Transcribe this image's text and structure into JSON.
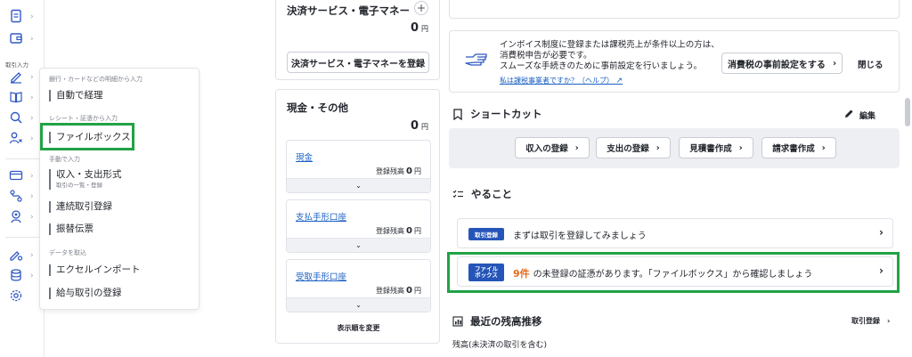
{
  "rail": {
    "label": "取引入力"
  },
  "flyout": {
    "groups": [
      "銀行・カードなどの明細から入力",
      "レシート・証憑から入力",
      "手動で入力",
      "データを取込"
    ],
    "items": {
      "auto": "自動で経理",
      "filebox": "ファイルボックス",
      "income_expense": "収入・支出形式",
      "income_expense_sub": "取引の一覧・登録",
      "continuous": "連続取引登録",
      "transfer": "振替伝票",
      "excel": "エクセルインポート",
      "payroll": "給与取引の登録"
    }
  },
  "payment": {
    "title": "決済サービス・電子マネー",
    "amount": "0",
    "unit": "円",
    "register_button": "決済サービス・電子マネーを登録"
  },
  "cash": {
    "title": "現金・その他",
    "amount": "0",
    "unit": "円",
    "balance_label": "登録残高",
    "accounts": [
      {
        "name": "現金",
        "balance": "0",
        "unit": "円"
      },
      {
        "name": "支払手形口座",
        "balance": "0",
        "unit": "円"
      },
      {
        "name": "受取手形口座",
        "balance": "0",
        "unit": "円"
      }
    ],
    "reorder": "表示順を変更"
  },
  "invoice": {
    "line1": "インボイス制度に登録または課税売上が条件以上の方は、",
    "line2": "消費税申告が必要です。",
    "line3": "スムーズな手続きのために事前設定を行いましょう。",
    "link": "私は課税事業者ですか？（ヘルプ）",
    "setup_button": "消費税の事前設定をする",
    "close": "閉じる"
  },
  "shortcut": {
    "title": "ショートカット",
    "edit": "編集",
    "buttons": [
      "収入の登録",
      "支出の登録",
      "見積書作成",
      "請求書作成"
    ]
  },
  "todo": {
    "title": "やること",
    "item1_badge": "取引登録",
    "item1_text": "まずは取引を登録してみましょう",
    "item2_badge_l1": "ファイル",
    "item2_badge_l2": "ボックス",
    "item2_count": "9件",
    "item2_text": "の未登録の証憑があります。「ファイルボックス」から確認しましょう"
  },
  "balance": {
    "title": "最近の残高推移",
    "link": "取引登録",
    "sub": "残高(未決済の取引を含む)"
  },
  "colors": {
    "accent": "#2555b8",
    "highlight": "#22a246",
    "count": "#e36b1d",
    "link": "#1a5fc2"
  }
}
